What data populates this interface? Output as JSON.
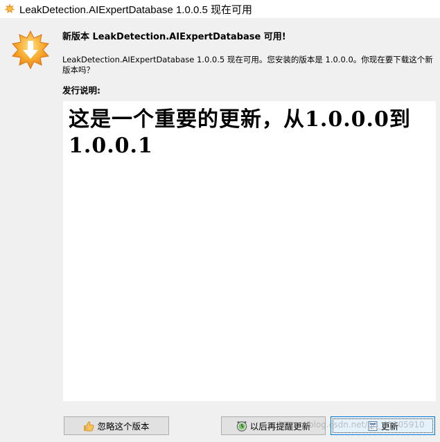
{
  "window": {
    "title": "LeakDetection.AIExpertDatabase 1.0.0.5 现在可用"
  },
  "dialog": {
    "heading": "新版本 LeakDetection.AIExpertDatabase 可用!",
    "message": "LeakDetection.AIExpertDatabase  1.0.0.5 现在可用。您安装的版本是 1.0.0.0。你现在要下载这个新版本吗？",
    "notes_label": "发行说明:",
    "notes_text": "这是一个重要的更新，从1.0.0.0到1.0.0.1"
  },
  "buttons": {
    "skip_label": "忽略这个版本",
    "remind_label": "以后再提醒更新",
    "install_label": "更新"
  },
  "watermark": "https://blog.csdn.net/qq_41105910",
  "icons": {
    "app": "update-star-icon",
    "big": "update-download-star-icon",
    "skip": "thumbs-up-icon",
    "remind": "clock-icon",
    "install": "install-icon"
  },
  "colors": {
    "accent": "#0078d7",
    "icon_orange": "#f5a623"
  }
}
